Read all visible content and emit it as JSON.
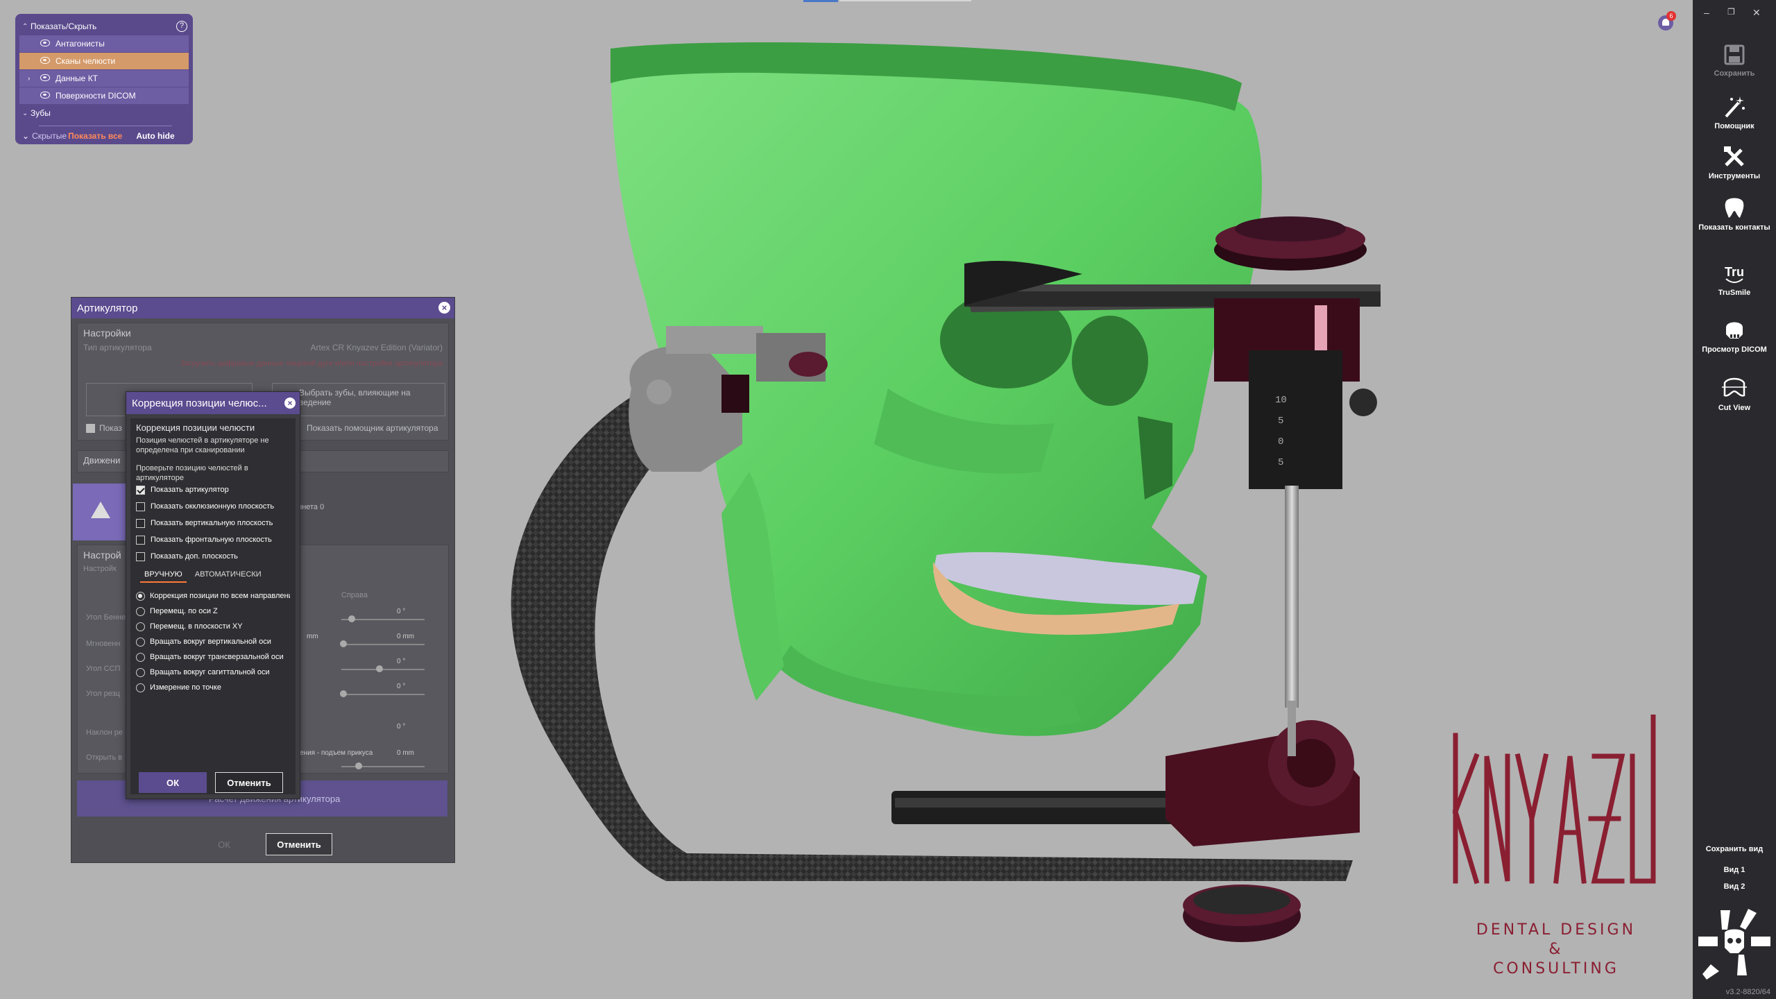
{
  "show_hide": {
    "title": "Показать/Скрыть",
    "help": "?",
    "items": [
      {
        "label": "Антагонисты",
        "selected": false
      },
      {
        "label": "Сканы челюсти",
        "selected": true
      },
      {
        "label": "Данные КТ",
        "selected": false
      },
      {
        "label": "Поверхности DICOM",
        "selected": false
      }
    ],
    "teeth_group": "Зубы",
    "hidden_label": "Скрытые",
    "show_all": "Показать все",
    "auto_hide": "Auto hide"
  },
  "articulator": {
    "title": "Артикулятор",
    "settings_header": "Настройки",
    "type_label": "Тип артикулятора",
    "type_value": "Artex CR Knyazev Edition (Variator)",
    "load_hint": "Загрузить цифровые данные лицевой дуги и/или настройки артикулятора",
    "select_teeth_button": "Выбрать зубы, влияющие на ведение",
    "show_check": "Показ",
    "helper_label": "Показать помощник артикулятора",
    "movement_label": "Движени",
    "bennett_label": "еннета 0",
    "settings2_header": "Настрой",
    "settings2_sub": "Настройк",
    "right_label": "Справа",
    "rows": [
      {
        "label": "Угол Бенне",
        "value": "0 °"
      },
      {
        "label": "Мгновенн",
        "unit": "mm",
        "value": "0 mm"
      },
      {
        "label": "Угол ССП",
        "value": "0 °"
      },
      {
        "label": "Угол резц",
        "value": "0 °"
      },
      {
        "label": "Наклон ре",
        "value": "0 °"
      },
      {
        "label": "Открыть в",
        "extra": "ения - подъем прикуса",
        "value": "0 mm"
      }
    ],
    "calc_label": "Расчет движения артикулятора",
    "ok": "ОК",
    "cancel": "Отменить"
  },
  "jaw_correction": {
    "title": "Коррекция позиции челюс...",
    "heading": "Коррекция позиции челюсти",
    "note": "Позиция челюстей в артикуляторе не определена при сканировании",
    "check_prompt": "Проверьте позицию челюстей в артикуляторе",
    "checks": [
      {
        "label": "Показать артикулятор",
        "checked": true
      },
      {
        "label": "Показать окклюзионную плоскость",
        "checked": false
      },
      {
        "label": "Показать вертикальную плоскость",
        "checked": false
      },
      {
        "label": "Показать фронтальную плоскость",
        "checked": false
      },
      {
        "label": "Показать доп. плоскость",
        "checked": false
      }
    ],
    "tab_manual": "ВРУЧНУЮ",
    "tab_auto": "АВТОМАТИЧЕСКИ",
    "radios": [
      {
        "label": "Коррекция позиции по всем направлениям",
        "checked": true
      },
      {
        "label": "Перемещ. по оси Z",
        "checked": false
      },
      {
        "label": "Перемещ. в плоскости XY",
        "checked": false
      },
      {
        "label": "Вращать вокруг вертикальной оси",
        "checked": false
      },
      {
        "label": "Вращать вокруг трансверзальной оси",
        "checked": false
      },
      {
        "label": "Вращать вокруг сагиттальной оси",
        "checked": false
      },
      {
        "label": "Измерение по точке",
        "checked": false
      }
    ],
    "ok": "ОК",
    "cancel": "Отменить"
  },
  "sidebar": {
    "tools": [
      {
        "label": "Сохранить",
        "icon": "save-icon",
        "enabled": false
      },
      {
        "label": "Помощник",
        "icon": "wand-icon",
        "enabled": true
      },
      {
        "label": "Инструменты",
        "icon": "tools-icon",
        "enabled": true
      },
      {
        "label": "Показать контакты",
        "icon": "tooth-contacts-icon",
        "enabled": true
      },
      {
        "label": "TruSmile",
        "icon": "trusmile-icon",
        "enabled": true
      },
      {
        "label": "Просмотр DICOM",
        "icon": "dicom-skull-icon",
        "enabled": true
      },
      {
        "label": "Cut View",
        "icon": "cut-view-icon",
        "enabled": true
      }
    ],
    "save_view": "Сохранить вид",
    "view1": "Вид 1",
    "view2": "Вид 2",
    "version": "v3.2-8820/64"
  },
  "notifications": {
    "count": "6"
  },
  "logo": {
    "line1": "DENTAL DESIGN",
    "line2": "&",
    "line3": "CONSULTING"
  },
  "colors": {
    "accent": "#5b4b8f",
    "skull": "#63d56b",
    "logo": "#8a1f32",
    "orange": "#ff7a3a"
  }
}
